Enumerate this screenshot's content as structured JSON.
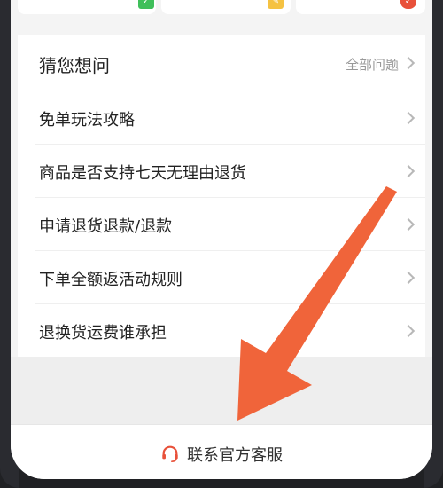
{
  "faq": {
    "title": "猜您想问",
    "all_label": "全部问题",
    "items": [
      {
        "label": "免单玩法攻略"
      },
      {
        "label": "商品是否支持七天无理由退货"
      },
      {
        "label": "申请退货退款/退款"
      },
      {
        "label": "下单全额返活动规则"
      },
      {
        "label": "退换货运费谁承担"
      }
    ]
  },
  "bottom": {
    "contact_label": "联系官方客服",
    "icon": "headset-icon"
  },
  "overlay": {
    "arrow_color": "#f0643a"
  },
  "colors": {
    "accent": "#e8513a",
    "green": "#3fbf5a",
    "yellow": "#f5c242"
  }
}
